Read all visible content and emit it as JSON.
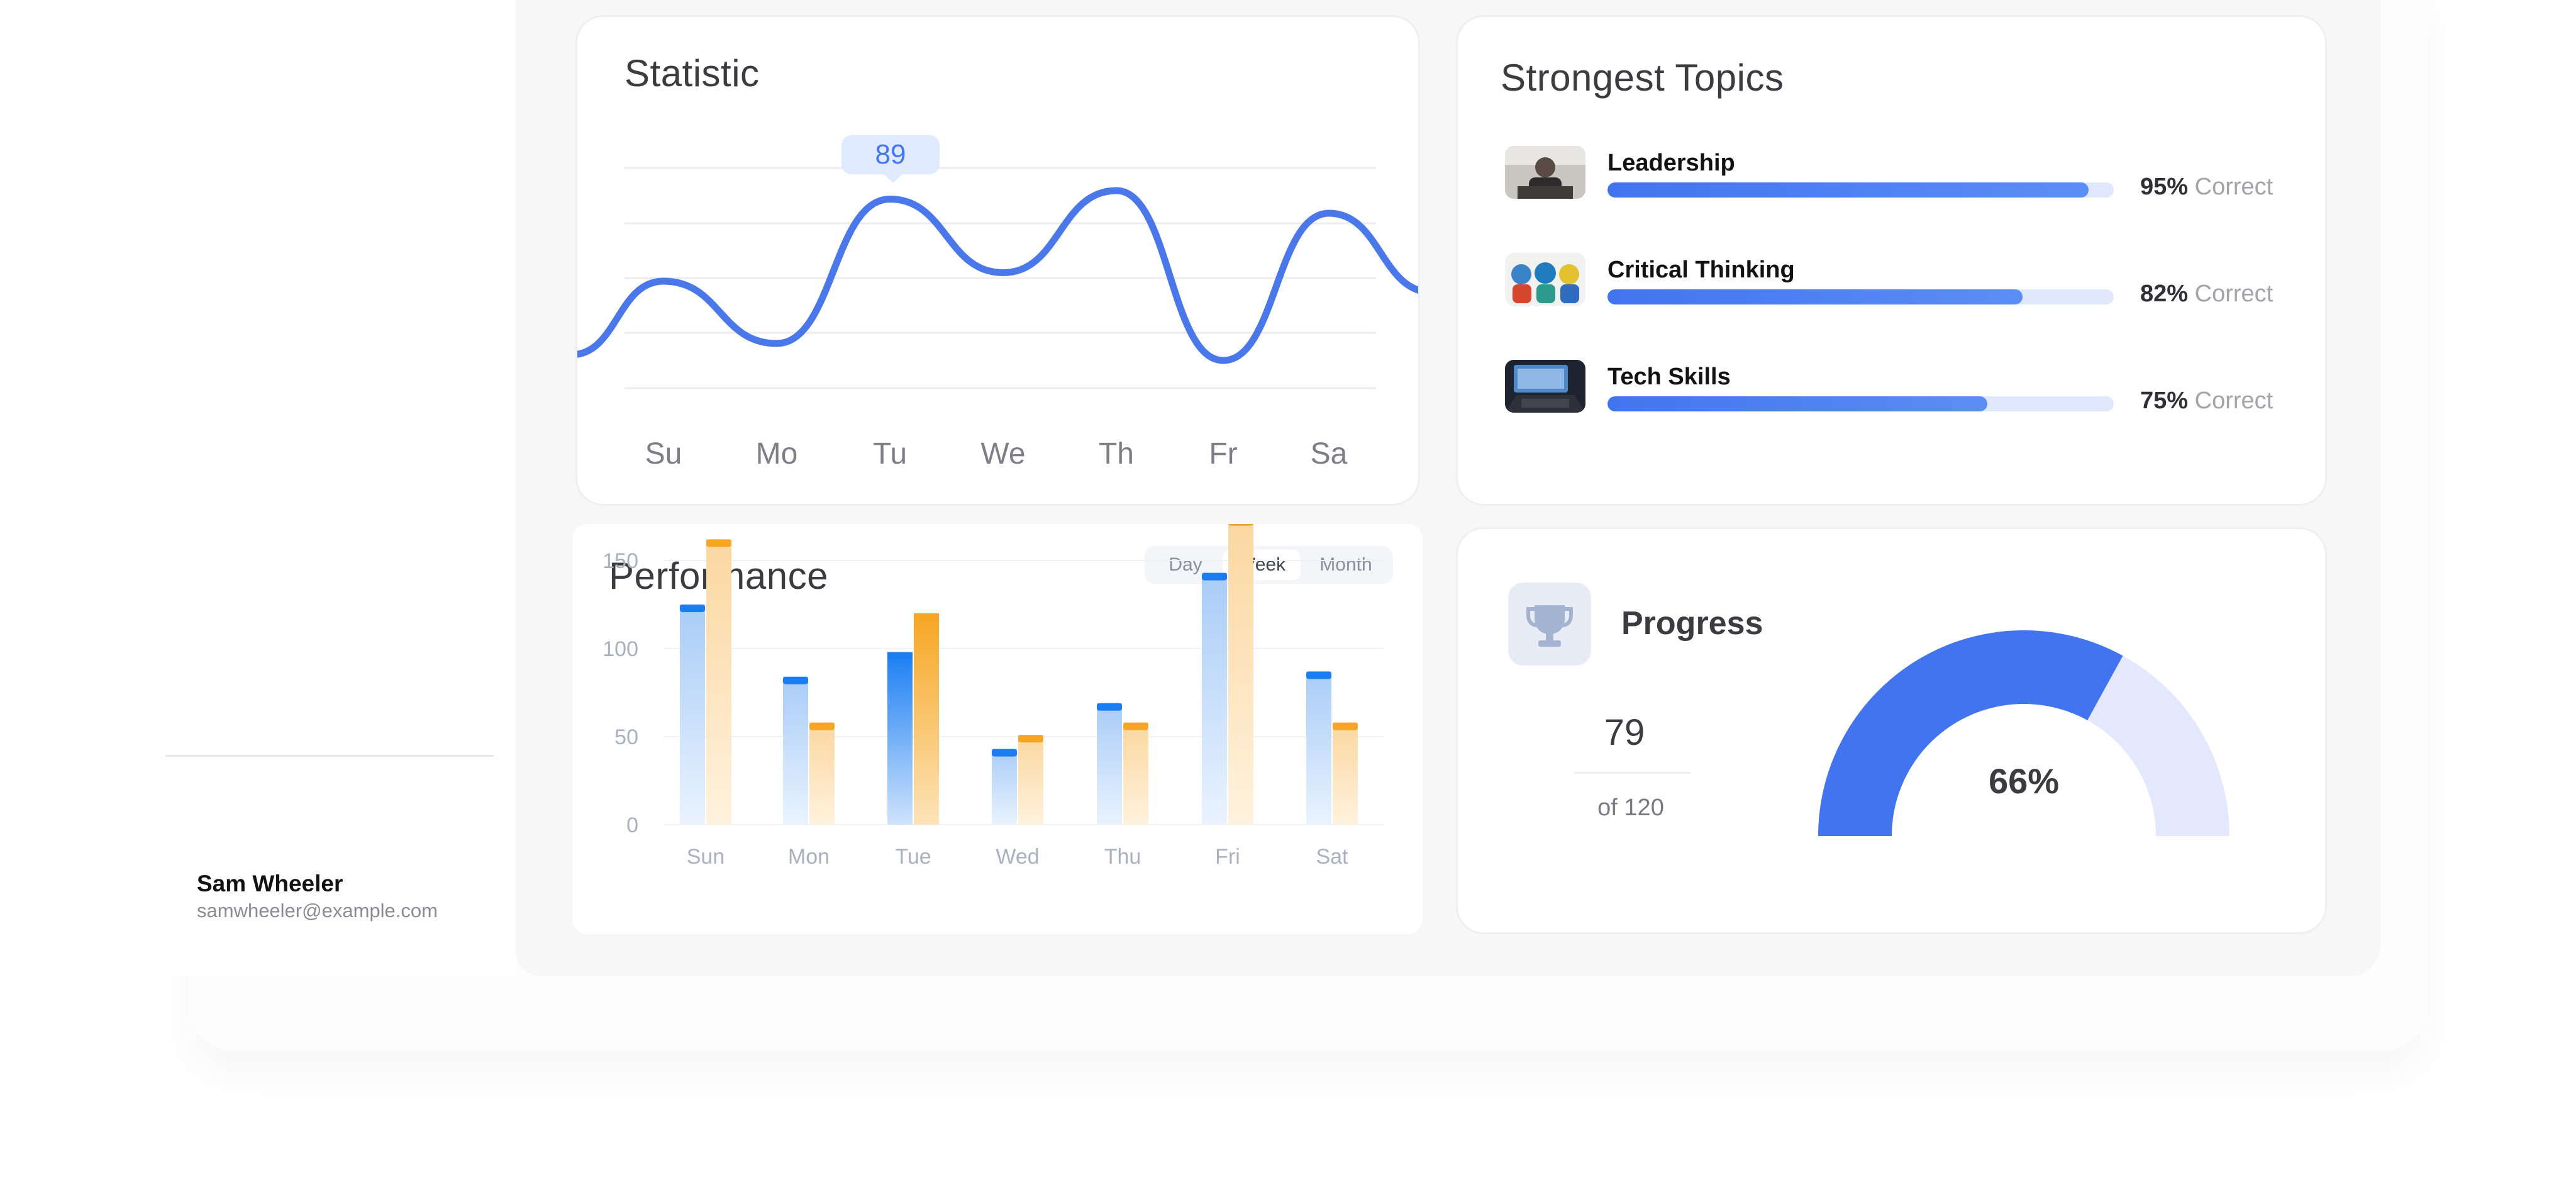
{
  "user": {
    "name": "Sam Wheeler",
    "email": "samwheeler@example.com"
  },
  "statistic": {
    "title": "Statistic",
    "highlight_value": "89",
    "chart_data": {
      "type": "line",
      "x": [
        "Su",
        "Mo",
        "Tu",
        "We",
        "Th",
        "Fr",
        "Sa"
      ],
      "series": [
        {
          "values": [
            60,
            38,
            89,
            63,
            92,
            32,
            84
          ]
        }
      ],
      "color": "#4a78ea",
      "grid": true
    }
  },
  "topics": {
    "title": "Strongest Topics",
    "correct_word": "Correct",
    "items": [
      {
        "name": "Leadership",
        "percent": 95,
        "percent_label": "95%"
      },
      {
        "name": "Critical Thinking",
        "percent": 82,
        "percent_label": "82%"
      },
      {
        "name": "Tech Skills",
        "percent": 75,
        "percent_label": "75%"
      }
    ]
  },
  "performance": {
    "title": "Performance",
    "tabs": [
      {
        "label": "Day",
        "active": false
      },
      {
        "label": "Week",
        "active": true
      },
      {
        "label": "Month",
        "active": false
      }
    ],
    "chart_data": {
      "type": "bar",
      "categories": [
        "Sun",
        "Mon",
        "Tue",
        "Wed",
        "Thu",
        "Fri",
        "Sat"
      ],
      "y_ticks": [
        "150",
        "100",
        "50",
        "0"
      ],
      "ylim": [
        0,
        150
      ],
      "series": [
        {
          "values": [
            125,
            84,
            98,
            43,
            69,
            143,
            87
          ],
          "color": "#1a7ef2"
        },
        {
          "values": [
            162,
            58,
            120,
            51,
            58,
            174,
            58
          ],
          "color": "#f6a623"
        }
      ],
      "grid": true
    }
  },
  "progress": {
    "title": "Progress",
    "value": "79",
    "total_label": "of 120",
    "percent_label": "66%",
    "chart_data": {
      "type": "gauge",
      "value": 66,
      "max": 100,
      "color": "#4274ef",
      "track_color": "#e3e8fd"
    },
    "icon": "trophy-icon"
  }
}
